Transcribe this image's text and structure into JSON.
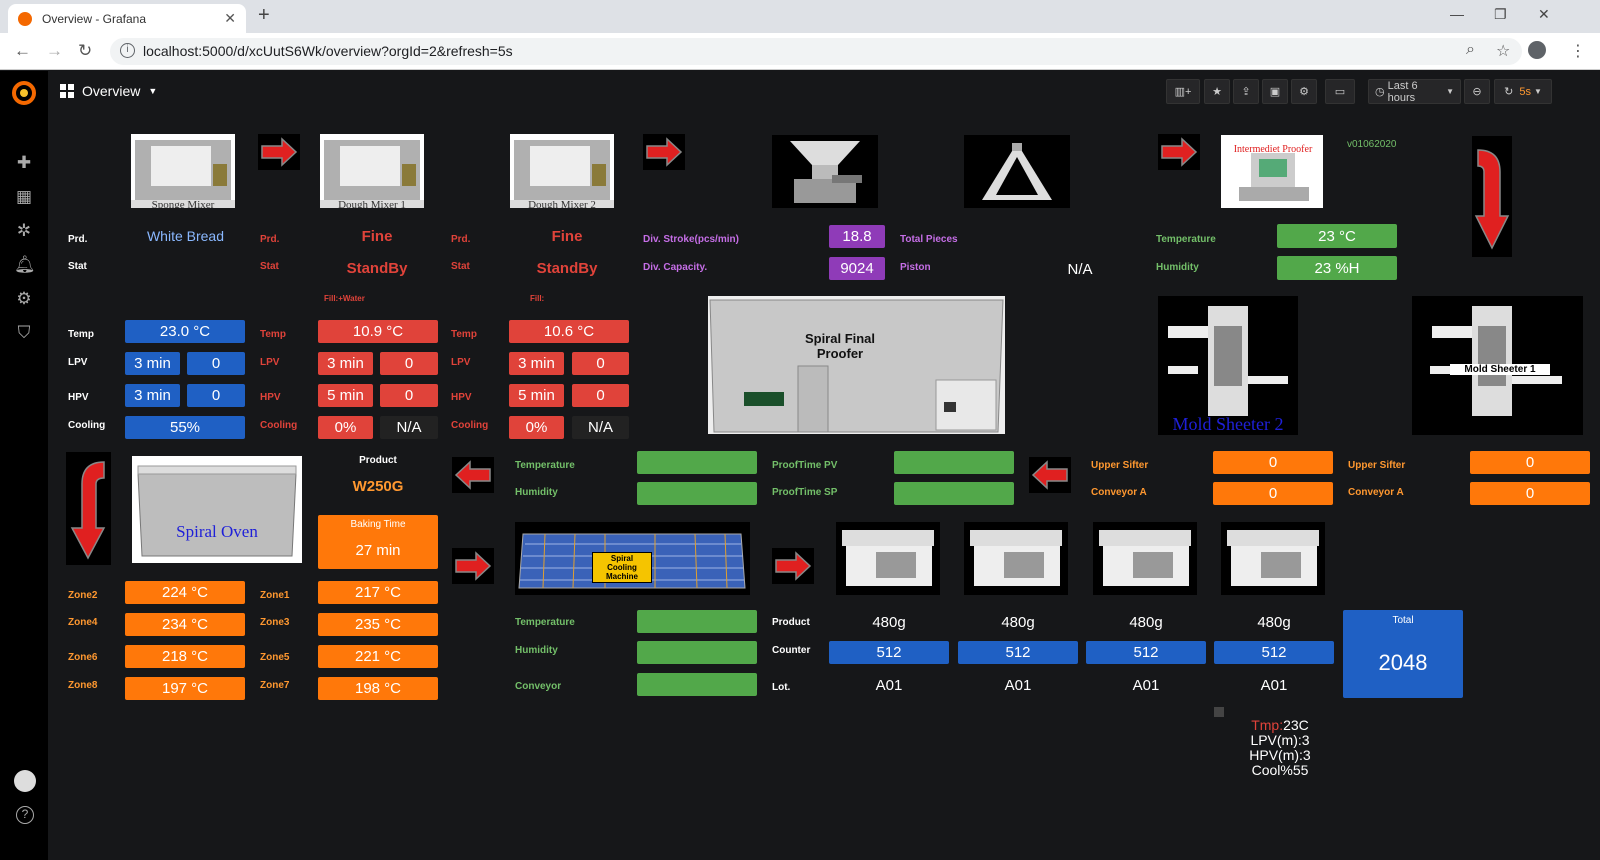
{
  "browser": {
    "tab_title": "Overview - Grafana",
    "url": "localhost:5000/d/xcUutS6Wk/overview?orgId=2&refresh=5s"
  },
  "dashboard": {
    "title": "Overview",
    "time_range": "Last 6 hours",
    "refresh": "5s"
  },
  "mixers": [
    {
      "caption": "Sponge Mixer",
      "prd_label": "Prd.",
      "prd": "White Bread",
      "stat_label": "Stat",
      "stat": "",
      "fill": "",
      "temp_label": "Temp",
      "temp": "23.0 °C",
      "lpv_label": "LPV",
      "lpv": "3 min",
      "lpv2": "0",
      "hpv_label": "HPV",
      "hpv": "3 min",
      "hpv2": "0",
      "cool_label": "Cooling",
      "cool": "55%",
      "cool2": ""
    },
    {
      "caption": "Dough Mixer 1",
      "prd_label": "Prd.",
      "prd": "Fine",
      "stat_label": "Stat",
      "stat": "StandBy",
      "fill": "Fill:+Water",
      "temp_label": "Temp",
      "temp": "10.9 °C",
      "lpv_label": "LPV",
      "lpv": "3 min",
      "lpv2": "0",
      "hpv_label": "HPV",
      "hpv": "5 min",
      "hpv2": "0",
      "cool_label": "Cooling",
      "cool": "0%",
      "cool2": "N/A"
    },
    {
      "caption": "Dough Mixer 2",
      "prd_label": "Prd.",
      "prd": "Fine",
      "stat_label": "Stat",
      "stat": "StandBy",
      "fill": "Fill:",
      "temp_label": "Temp",
      "temp": "10.6 °C",
      "lpv_label": "LPV",
      "lpv": "3 min",
      "lpv2": "0",
      "hpv_label": "HPV",
      "hpv": "5 min",
      "hpv2": "0",
      "cool_label": "Cooling",
      "cool": "0%",
      "cool2": "N/A"
    }
  ],
  "divider": {
    "stroke_label": "Div. Stroke(pcs/min)",
    "stroke": "18.8",
    "capacity_label": "Div. Capacity.",
    "capacity": "9024",
    "pieces_label": "Total Pieces",
    "piston_label": "Piston",
    "piston": "N/A"
  },
  "intermediate": {
    "caption": "Intermediet Proofer",
    "version": "v01062020",
    "temp_label": "Temperature",
    "temp": "23 °C",
    "hum_label": "Humidity",
    "hum": "23 %H"
  },
  "spiral_proofer": {
    "caption": "Spiral Final Proofer",
    "temp_label": "Temperature",
    "hum_label": "Humidity",
    "pv_label": "ProofTime PV",
    "sp_label": "ProofTime SP"
  },
  "sheeters": {
    "caption1": "Mold Sheeter 2",
    "caption2": "Mold Sheeter 1",
    "sifter_label": "Upper Sifter",
    "conveyor_label": "Conveyor A",
    "s1_sifter": "0",
    "s1_conveyor": "0",
    "s2_sifter": "0",
    "s2_conveyor": "0"
  },
  "oven": {
    "caption": "Spiral Oven",
    "product_label": "Product",
    "product": "W250G",
    "baking_label": "Baking Time",
    "baking": "27 min",
    "zones_left": [
      {
        "label": "Zone2",
        "value": "224 °C"
      },
      {
        "label": "Zone4",
        "value": "234 °C"
      },
      {
        "label": "Zone6",
        "value": "218 °C"
      },
      {
        "label": "Zone8",
        "value": "197 °C"
      }
    ],
    "zones_right": [
      {
        "label": "Zone1",
        "value": "217 °C"
      },
      {
        "label": "Zone3",
        "value": "235 °C"
      },
      {
        "label": "Zone5",
        "value": "221 °C"
      },
      {
        "label": "Zone7",
        "value": "198 °C"
      }
    ]
  },
  "cooling": {
    "caption": "Spiral Cooling Machine",
    "temp_label": "Temperature",
    "hum_label": "Humidity",
    "conv_label": "Conveyor"
  },
  "packers": {
    "product_label": "Product",
    "counter_label": "Counter",
    "lot_label": "Lot.",
    "units": [
      {
        "product": "480g",
        "counter": "512",
        "lot": "A01"
      },
      {
        "product": "480g",
        "counter": "512",
        "lot": "A01"
      },
      {
        "product": "480g",
        "counter": "512",
        "lot": "A01"
      },
      {
        "product": "480g",
        "counter": "512",
        "lot": "A01"
      }
    ],
    "total_label": "Total",
    "total": "2048"
  },
  "summary": {
    "tmp_key": "Tmp:",
    "tmp_val": "23C",
    "lpv": "LPV(m):3",
    "hpv": "HPV(m):3",
    "cool": "Cool%55"
  }
}
